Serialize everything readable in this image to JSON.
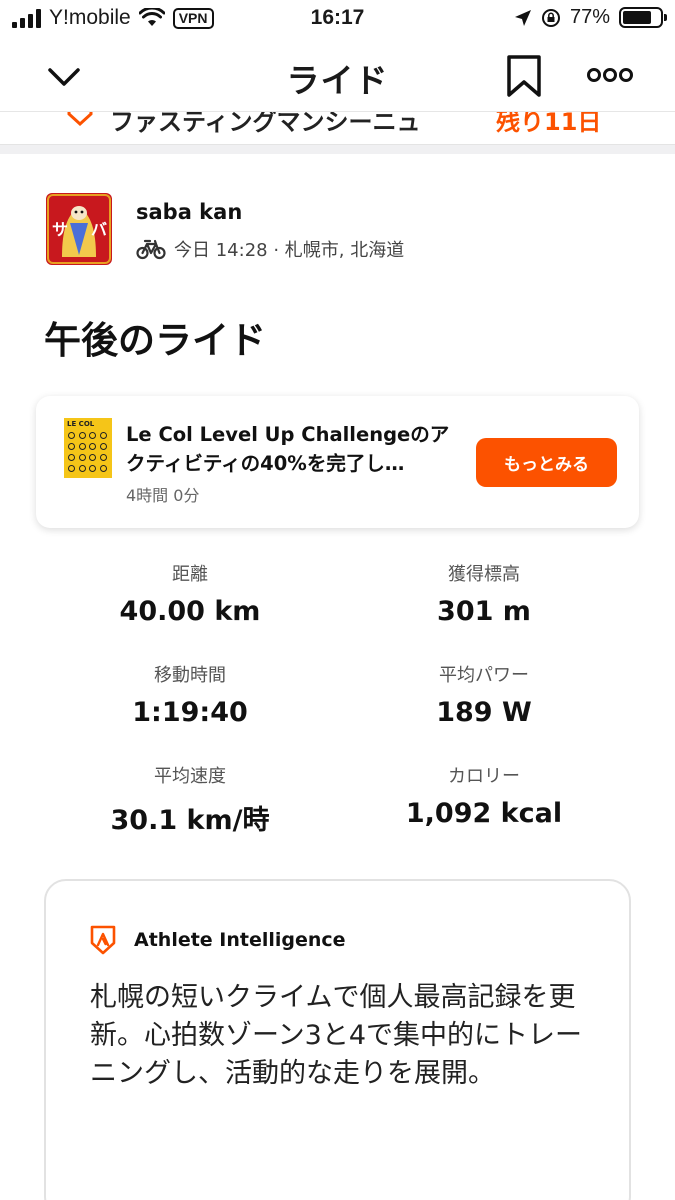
{
  "status_bar": {
    "carrier": "Y!mobile",
    "vpn": "VPN",
    "time": "16:17",
    "battery_percent": "77%",
    "battery_level": 0.77
  },
  "nav": {
    "title": "ライド"
  },
  "peek": {
    "text": "ファスティングマンシーニュ",
    "right": "残り11日"
  },
  "athlete": {
    "name": "saba kan",
    "meta": "今日 14:28 · 札幌市, 北海道",
    "avatar_text_left": "サ",
    "avatar_text_right": "バ"
  },
  "activity": {
    "title": "午後のライド"
  },
  "challenge": {
    "badge_label": "LE COL",
    "title": "Le Col Level Up Challengeのアクティビティの40%を完了し…",
    "duration": "4時間 0分",
    "button_label": "もっとみる",
    "accent_color": "#fc5200"
  },
  "stats": [
    {
      "label": "距離",
      "value": "40.00 km"
    },
    {
      "label": "獲得標高",
      "value": "301 m"
    },
    {
      "label": "移動時間",
      "value": "1:19:40"
    },
    {
      "label": "平均パワー",
      "value": "189 W"
    },
    {
      "label": "平均速度",
      "value": "30.1 km/時"
    },
    {
      "label": "カロリー",
      "value": "1,092 kcal"
    }
  ],
  "athlete_intelligence": {
    "title": "Athlete Intelligence",
    "body": "札幌の短いクライムで個人最高記録を更新。心拍数ゾーン3と4で集中的にトレーニングし、活動的な走りを展開。"
  },
  "icons": {
    "back": "chevron-down-icon",
    "bookmark": "bookmark-icon",
    "more": "more-icon",
    "sport": "bike-icon",
    "ai": "athlete-intelligence-icon"
  }
}
